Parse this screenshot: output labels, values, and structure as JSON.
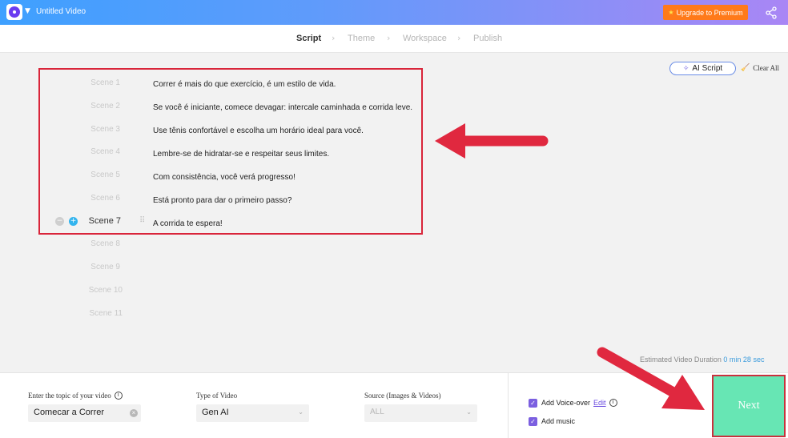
{
  "header": {
    "video_title": "Untitled Video",
    "upgrade_label": "Upgrade to Premium",
    "share_icon": "share-icon"
  },
  "steps": [
    {
      "label": "Script",
      "active": true
    },
    {
      "label": "Theme",
      "active": false
    },
    {
      "label": "Workspace",
      "active": false
    },
    {
      "label": "Publish",
      "active": false
    }
  ],
  "toolbar": {
    "ai_script_label": "AI Script",
    "clear_all_label": "Clear All"
  },
  "scenes": [
    {
      "label": "Scene 1",
      "text": "Correr é mais do que exercício, é um estilo de vida."
    },
    {
      "label": "Scene 2",
      "text": "Se você é iniciante, comece devagar: intercale caminhada e corrida leve."
    },
    {
      "label": "Scene 3",
      "text": "Use tênis confortável e escolha um horário ideal para você."
    },
    {
      "label": "Scene 4",
      "text": "Lembre-se de hidratar-se e respeitar seus limites."
    },
    {
      "label": "Scene 5",
      "text": "Com consistência, você verá progresso!"
    },
    {
      "label": "Scene 6",
      "text": "Está pronto para dar o primeiro passo?"
    },
    {
      "label": "Scene 7",
      "text": "A corrida te espera!",
      "active": true
    },
    {
      "label": "Scene 8",
      "text": ""
    },
    {
      "label": "Scene 9",
      "text": ""
    },
    {
      "label": "Scene 10",
      "text": ""
    },
    {
      "label": "Scene 11",
      "text": ""
    }
  ],
  "duration": {
    "label": "Estimated Video Duration",
    "value": "0 min 28 sec"
  },
  "form": {
    "topic_label": "Enter the topic of your video",
    "topic_value": "Comecar a Correr",
    "type_label": "Type of Video",
    "type_value": "Gen AI",
    "source_label": "Source (Images & Videos)",
    "source_value": "ALL",
    "voiceover_label": "Add Voice-over",
    "voiceover_edit": "Edit",
    "music_label": "Add music",
    "next_label": "Next"
  },
  "colors": {
    "accent": "#7b5fe0",
    "next_bg": "#67e6b4",
    "annotation_red": "#e0283f"
  }
}
